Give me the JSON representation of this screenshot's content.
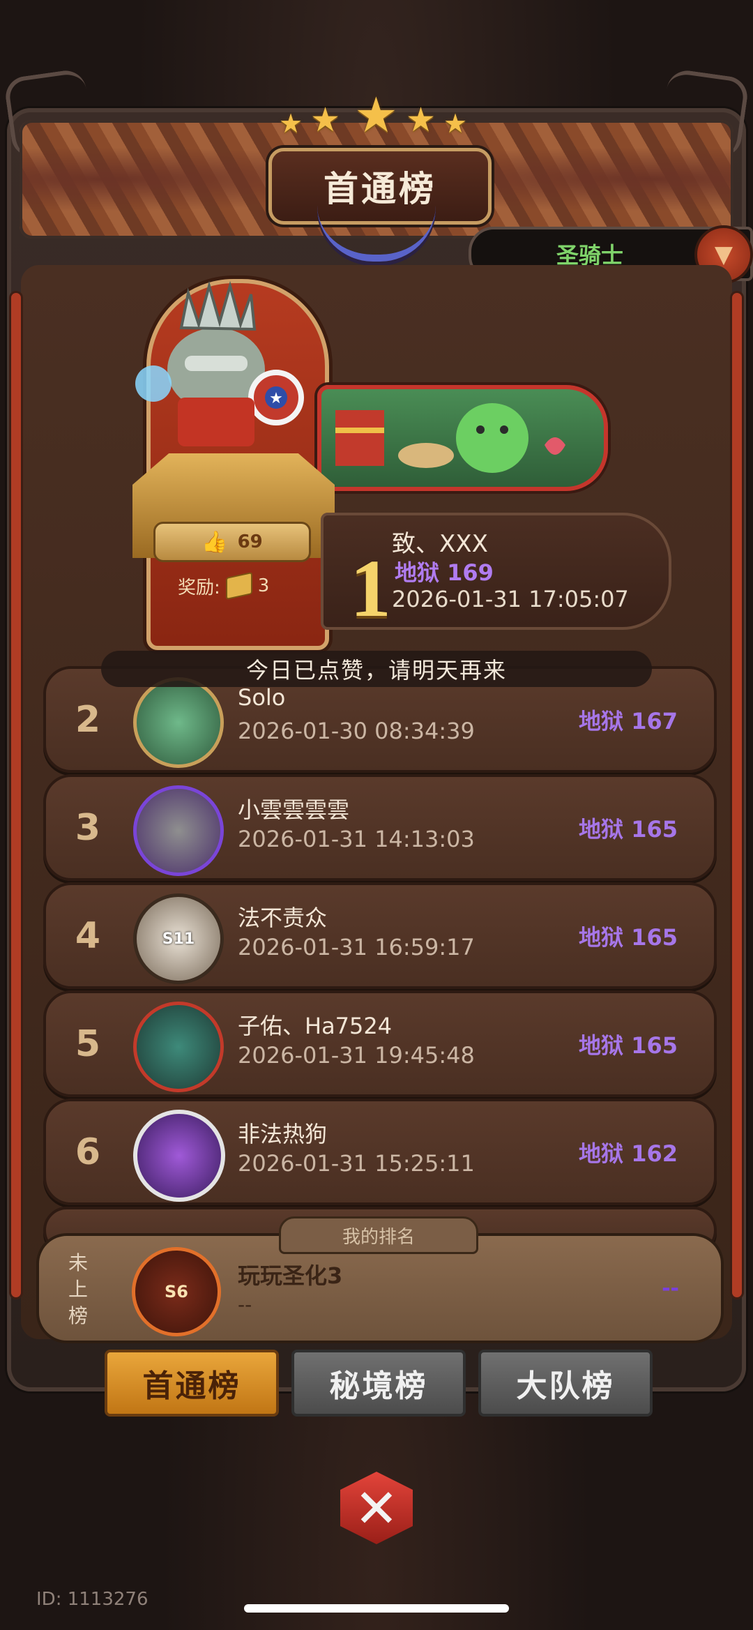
{
  "header": {
    "title": "首通榜",
    "class_filter": "圣骑士"
  },
  "top1": {
    "rank": "1",
    "name": "致、XXX",
    "level": "地狱 169",
    "time": "2026-01-31 17:05:07",
    "likes": "69",
    "reward_label": "奖励:",
    "reward_count": "3"
  },
  "toast": "今日已点赞，请明天再来",
  "rows": [
    {
      "rank": "2",
      "name": "Solo",
      "time": "2026-01-30 08:34:39",
      "level": "地狱 167"
    },
    {
      "rank": "3",
      "name": "小雲雲雲雲",
      "time": "2026-01-31 14:13:03",
      "level": "地狱 165"
    },
    {
      "rank": "4",
      "name": "法不责众",
      "time": "2026-01-31 16:59:17",
      "level": "地狱 165",
      "badge": "S11"
    },
    {
      "rank": "5",
      "name": "子佑、Ha7524",
      "time": "2026-01-31 19:45:48",
      "level": "地狱 165"
    },
    {
      "rank": "6",
      "name": "非法热狗",
      "time": "2026-01-31 15:25:11",
      "level": "地狱 162"
    }
  ],
  "my_rank": {
    "tab_label": "我的排名",
    "rank_text": "未上榜",
    "badge": "S6",
    "name": "玩玩圣化3",
    "sub": "--",
    "level": "--"
  },
  "tabs": [
    {
      "label": "首通榜",
      "active": true
    },
    {
      "label": "秘境榜",
      "active": false
    },
    {
      "label": "大队榜",
      "active": false
    }
  ],
  "player_id": "ID: 1113276",
  "colors": {
    "accent_gold": "#f5d36b",
    "level_purple": "#a676e8",
    "filter_green": "#7fd36a",
    "tab_active": "#e9a63b"
  }
}
